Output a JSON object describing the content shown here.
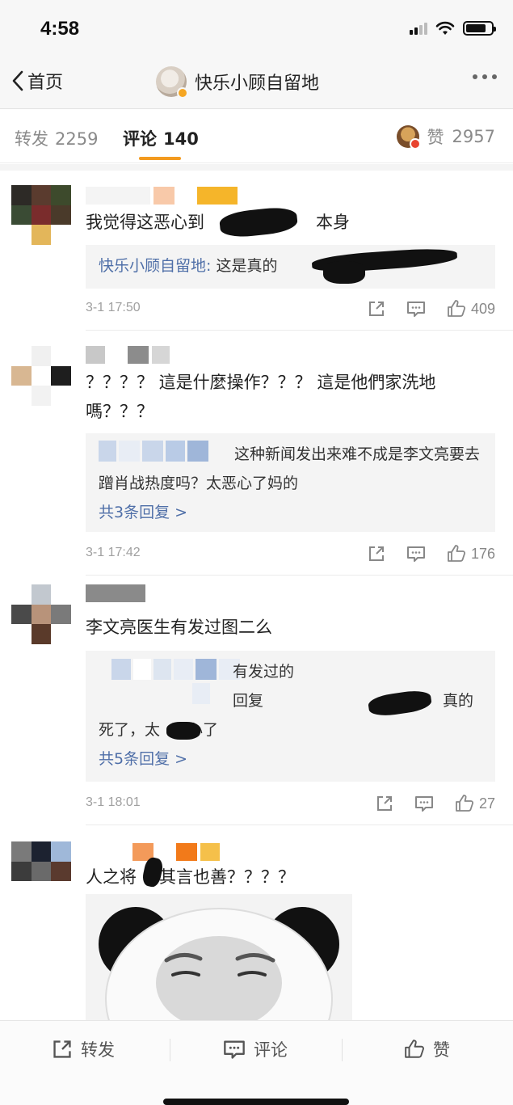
{
  "status_bar": {
    "time": "4:58"
  },
  "nav": {
    "back_label": "首页",
    "title": "快乐小顾自留地"
  },
  "tabs": {
    "repost": {
      "label": "转发",
      "count": "2259"
    },
    "comment": {
      "label": "评论",
      "count": "140"
    },
    "like": {
      "label": "赞",
      "count": "2957"
    }
  },
  "comments": [
    {
      "text": "我觉得这恶心到",
      "text_tail": "本身",
      "reply_author": "快乐小顾自留地:",
      "reply_text": "这是真的",
      "timestamp": "3-1 17:50",
      "likes": "409"
    },
    {
      "text": "？？？？ 這是什麼操作？？？ 這是他們家洗地嗎？？？",
      "reply_text": "这种新闻发出来难不成是李文亮要去蹭肖战热度吗？太恶心了妈的",
      "reply_count": "共3条回复 >",
      "timestamp": "3-1 17:42",
      "likes": "176"
    },
    {
      "text": "李文亮医生有发过图二么",
      "reply_line1": "有发过的",
      "reply_line2_a": "回复",
      "reply_line2_b": "真的",
      "reply_line3_a": "死了，太",
      "reply_line3_b": "心了",
      "reply_count": "共5条回复 >",
      "timestamp": "3-1 18:01",
      "likes": "27"
    },
    {
      "text_a": "人之将",
      "text_b": "其言也善？？？？"
    }
  ],
  "bottom_bar": {
    "repost": "转发",
    "comment": "评论",
    "like": "赞"
  },
  "colors": {
    "accent": "#f39a1f",
    "link": "#4f6fa8",
    "background": "#ffffff"
  }
}
